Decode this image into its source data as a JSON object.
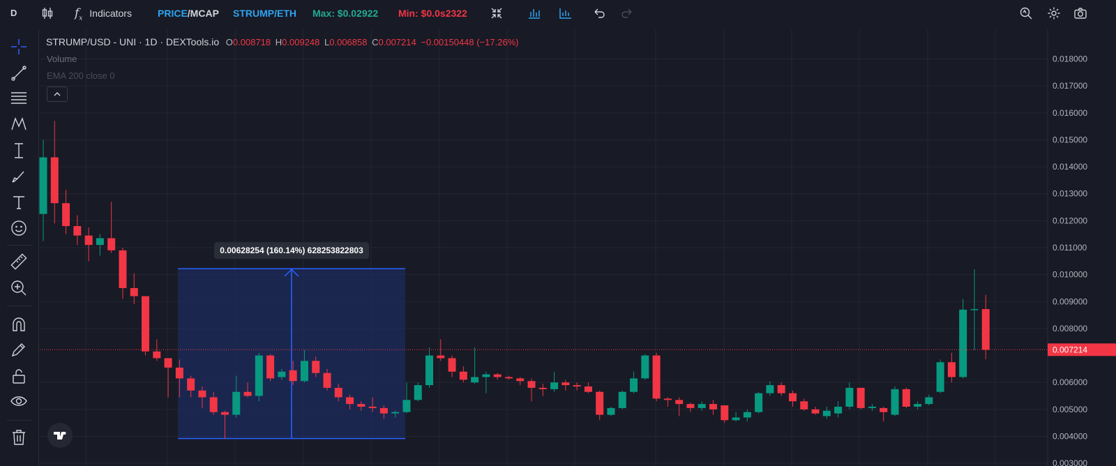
{
  "topbar": {
    "symbol_short": "D",
    "indicators_label": "Indicators",
    "price_label": "PRICE",
    "mcap_label": "/MCAP",
    "pair_label": "STRUMP/ETH",
    "max_label": "Max: $0.02922",
    "min_label": "Min: $0.0s2322"
  },
  "legend": {
    "title": "STRUMP/USD - UNI · 1D · DEXTools.io",
    "o_label": "O",
    "o_value": "0.008718",
    "h_label": "H",
    "h_value": "0.009248",
    "l_label": "L",
    "l_value": "0.006858",
    "c_label": "C",
    "c_value": "0.007214",
    "change": "−0.00150448 (−17.26%)",
    "volume_label": "Volume",
    "ema_label": "EMA 200 close 0"
  },
  "measure": {
    "label": "0.00628254 (160.14%) 628253822803",
    "from": 0.00392,
    "to": 0.01022
  },
  "colors": {
    "background": "#181a25",
    "up": "#089981",
    "down": "#f23645",
    "grid": "#232634",
    "measure_fill": "#1c2c60",
    "measure_line": "#2962ff",
    "accent_blue": "#2da4f0",
    "max_green": "#22ab94",
    "min_red": "#f23645"
  },
  "chart_data": {
    "type": "candlestick",
    "title": "STRUMP/USD - UNI · 1D · DEXTools.io",
    "yaxis": {
      "min": 0.0029,
      "max": 0.0191,
      "ticks": [
        "0.018000",
        "0.017000",
        "0.016000",
        "0.015000",
        "0.014000",
        "0.013000",
        "0.012000",
        "0.011000",
        "0.010000",
        "0.009000",
        "0.008000",
        "0.006000",
        "0.005000",
        "0.004000",
        "0.003000"
      ],
      "last_price": "0.007214",
      "last_value": 0.007214
    },
    "candles": [
      {
        "o": 0.01225,
        "h": 0.015,
        "l": 0.01125,
        "c": 0.01435
      },
      {
        "o": 0.01435,
        "h": 0.0157,
        "l": 0.0119,
        "c": 0.01265
      },
      {
        "o": 0.01265,
        "h": 0.01315,
        "l": 0.0115,
        "c": 0.0118
      },
      {
        "o": 0.0118,
        "h": 0.0122,
        "l": 0.0111,
        "c": 0.01145
      },
      {
        "o": 0.01145,
        "h": 0.01175,
        "l": 0.0105,
        "c": 0.0111
      },
      {
        "o": 0.0111,
        "h": 0.0115,
        "l": 0.0107,
        "c": 0.01135
      },
      {
        "o": 0.01135,
        "h": 0.0127,
        "l": 0.0108,
        "c": 0.0109
      },
      {
        "o": 0.0109,
        "h": 0.011,
        "l": 0.0091,
        "c": 0.0095
      },
      {
        "o": 0.0095,
        "h": 0.01005,
        "l": 0.0089,
        "c": 0.0092
      },
      {
        "o": 0.0092,
        "h": 0.0092,
        "l": 0.007,
        "c": 0.00715
      },
      {
        "o": 0.00715,
        "h": 0.0076,
        "l": 0.0068,
        "c": 0.0069
      },
      {
        "o": 0.0069,
        "h": 0.0069,
        "l": 0.00545,
        "c": 0.00655
      },
      {
        "o": 0.00655,
        "h": 0.00685,
        "l": 0.00545,
        "c": 0.00615
      },
      {
        "o": 0.00615,
        "h": 0.00625,
        "l": 0.00545,
        "c": 0.0057
      },
      {
        "o": 0.0057,
        "h": 0.00585,
        "l": 0.00505,
        "c": 0.00545
      },
      {
        "o": 0.00545,
        "h": 0.00565,
        "l": 0.0048,
        "c": 0.0049
      },
      {
        "o": 0.0049,
        "h": 0.00495,
        "l": 0.00392,
        "c": 0.0048
      },
      {
        "o": 0.0048,
        "h": 0.00625,
        "l": 0.0047,
        "c": 0.00565
      },
      {
        "o": 0.00565,
        "h": 0.006,
        "l": 0.00545,
        "c": 0.0055
      },
      {
        "o": 0.0055,
        "h": 0.0071,
        "l": 0.0053,
        "c": 0.007
      },
      {
        "o": 0.007,
        "h": 0.00705,
        "l": 0.00605,
        "c": 0.00615
      },
      {
        "o": 0.0062,
        "h": 0.0065,
        "l": 0.0061,
        "c": 0.0064
      },
      {
        "o": 0.00645,
        "h": 0.0068,
        "l": 0.0059,
        "c": 0.00605
      },
      {
        "o": 0.00605,
        "h": 0.0072,
        "l": 0.006,
        "c": 0.0068
      },
      {
        "o": 0.0068,
        "h": 0.00695,
        "l": 0.0062,
        "c": 0.00635
      },
      {
        "o": 0.00635,
        "h": 0.0065,
        "l": 0.0057,
        "c": 0.0058
      },
      {
        "o": 0.0058,
        "h": 0.00595,
        "l": 0.0053,
        "c": 0.00545
      },
      {
        "o": 0.00545,
        "h": 0.00555,
        "l": 0.005,
        "c": 0.0052
      },
      {
        "o": 0.0052,
        "h": 0.0053,
        "l": 0.00495,
        "c": 0.0051
      },
      {
        "o": 0.0051,
        "h": 0.00545,
        "l": 0.0049,
        "c": 0.00505
      },
      {
        "o": 0.00505,
        "h": 0.00515,
        "l": 0.00465,
        "c": 0.00485
      },
      {
        "o": 0.00485,
        "h": 0.00495,
        "l": 0.0047,
        "c": 0.0049
      },
      {
        "o": 0.0049,
        "h": 0.006,
        "l": 0.00485,
        "c": 0.00535
      },
      {
        "o": 0.00535,
        "h": 0.006,
        "l": 0.0053,
        "c": 0.0059
      },
      {
        "o": 0.0059,
        "h": 0.0073,
        "l": 0.0058,
        "c": 0.007
      },
      {
        "o": 0.007,
        "h": 0.0076,
        "l": 0.0068,
        "c": 0.0069
      },
      {
        "o": 0.0069,
        "h": 0.007,
        "l": 0.0062,
        "c": 0.0064
      },
      {
        "o": 0.0064,
        "h": 0.0066,
        "l": 0.006,
        "c": 0.0061
      },
      {
        "o": 0.006,
        "h": 0.0073,
        "l": 0.00595,
        "c": 0.0062
      },
      {
        "o": 0.0062,
        "h": 0.0064,
        "l": 0.0056,
        "c": 0.0063
      },
      {
        "o": 0.0063,
        "h": 0.00635,
        "l": 0.0061,
        "c": 0.0062
      },
      {
        "o": 0.0062,
        "h": 0.00625,
        "l": 0.0061,
        "c": 0.00615
      },
      {
        "o": 0.00615,
        "h": 0.0062,
        "l": 0.0059,
        "c": 0.00605
      },
      {
        "o": 0.00605,
        "h": 0.00615,
        "l": 0.0053,
        "c": 0.0058
      },
      {
        "o": 0.0058,
        "h": 0.00595,
        "l": 0.0055,
        "c": 0.00575
      },
      {
        "o": 0.00575,
        "h": 0.0064,
        "l": 0.00565,
        "c": 0.006
      },
      {
        "o": 0.006,
        "h": 0.0061,
        "l": 0.0057,
        "c": 0.0059
      },
      {
        "o": 0.0059,
        "h": 0.006,
        "l": 0.0057,
        "c": 0.00585
      },
      {
        "o": 0.00585,
        "h": 0.006,
        "l": 0.0056,
        "c": 0.00565
      },
      {
        "o": 0.00565,
        "h": 0.0057,
        "l": 0.0046,
        "c": 0.0048
      },
      {
        "o": 0.0048,
        "h": 0.0051,
        "l": 0.00475,
        "c": 0.00505
      },
      {
        "o": 0.00505,
        "h": 0.0057,
        "l": 0.005,
        "c": 0.00565
      },
      {
        "o": 0.00565,
        "h": 0.0064,
        "l": 0.0056,
        "c": 0.00615
      },
      {
        "o": 0.00615,
        "h": 0.00705,
        "l": 0.0061,
        "c": 0.007
      },
      {
        "o": 0.007,
        "h": 0.0071,
        "l": 0.0053,
        "c": 0.0054
      },
      {
        "o": 0.0054,
        "h": 0.00545,
        "l": 0.0051,
        "c": 0.00535
      },
      {
        "o": 0.00535,
        "h": 0.00545,
        "l": 0.00475,
        "c": 0.0052
      },
      {
        "o": 0.0052,
        "h": 0.00525,
        "l": 0.0049,
        "c": 0.00505
      },
      {
        "o": 0.00505,
        "h": 0.0053,
        "l": 0.00495,
        "c": 0.0052
      },
      {
        "o": 0.0052,
        "h": 0.00535,
        "l": 0.0048,
        "c": 0.005
      },
      {
        "o": 0.00515,
        "h": 0.00515,
        "l": 0.0045,
        "c": 0.0046
      },
      {
        "o": 0.0046,
        "h": 0.0049,
        "l": 0.00455,
        "c": 0.0047
      },
      {
        "o": 0.0047,
        "h": 0.005,
        "l": 0.00455,
        "c": 0.0049
      },
      {
        "o": 0.0049,
        "h": 0.00565,
        "l": 0.00485,
        "c": 0.0056
      },
      {
        "o": 0.0056,
        "h": 0.00605,
        "l": 0.0055,
        "c": 0.0059
      },
      {
        "o": 0.0059,
        "h": 0.006,
        "l": 0.0055,
        "c": 0.0056
      },
      {
        "o": 0.0056,
        "h": 0.0057,
        "l": 0.0051,
        "c": 0.0053
      },
      {
        "o": 0.0053,
        "h": 0.0054,
        "l": 0.00495,
        "c": 0.005
      },
      {
        "o": 0.005,
        "h": 0.0051,
        "l": 0.0048,
        "c": 0.00485
      },
      {
        "o": 0.00475,
        "h": 0.0051,
        "l": 0.00465,
        "c": 0.00495
      },
      {
        "o": 0.00485,
        "h": 0.0053,
        "l": 0.0047,
        "c": 0.0051
      },
      {
        "o": 0.0051,
        "h": 0.006,
        "l": 0.005,
        "c": 0.0058
      },
      {
        "o": 0.0058,
        "h": 0.0058,
        "l": 0.005,
        "c": 0.00505
      },
      {
        "o": 0.00505,
        "h": 0.0052,
        "l": 0.00495,
        "c": 0.0051
      },
      {
        "o": 0.00505,
        "h": 0.0051,
        "l": 0.00455,
        "c": 0.0049
      },
      {
        "o": 0.0048,
        "h": 0.00585,
        "l": 0.00475,
        "c": 0.00575
      },
      {
        "o": 0.00575,
        "h": 0.0058,
        "l": 0.00505,
        "c": 0.0051
      },
      {
        "o": 0.0051,
        "h": 0.0053,
        "l": 0.005,
        "c": 0.0052
      },
      {
        "o": 0.0052,
        "h": 0.00555,
        "l": 0.00515,
        "c": 0.00545
      },
      {
        "o": 0.00565,
        "h": 0.00685,
        "l": 0.0056,
        "c": 0.00675
      },
      {
        "o": 0.00675,
        "h": 0.0071,
        "l": 0.006,
        "c": 0.0062
      },
      {
        "o": 0.0062,
        "h": 0.0091,
        "l": 0.00615,
        "c": 0.0087
      },
      {
        "o": 0.0087,
        "h": 0.0102,
        "l": 0.0072,
        "c": 0.00872
      },
      {
        "o": 0.00872,
        "h": 0.00925,
        "l": 0.00686,
        "c": 0.00721
      }
    ]
  }
}
